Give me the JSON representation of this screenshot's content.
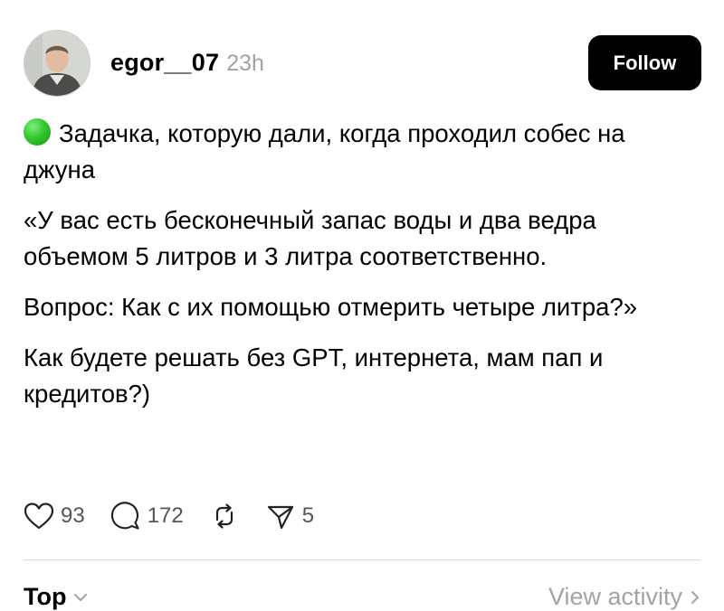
{
  "post": {
    "author": {
      "username": "egor__07",
      "time_ago": "23h"
    },
    "follow_label": "Follow",
    "status_dot_color": "#2fbf2b",
    "paragraphs": [
      "Задачка, которую дали, когда проходил собес на джуна",
      "«У вас есть бесконечный запас воды и два ведра объемом 5 литров и 3 литра соответственно.",
      "Вопрос: Как с их помощью отмерить четыре литра?»",
      "Как будете решать без GPT, интернета, мам пап и кредитов?)"
    ]
  },
  "actions": {
    "likes": "93",
    "comments": "172",
    "shares": "5",
    "icons": [
      "heart-icon",
      "comment-icon",
      "repost-icon",
      "share-icon"
    ]
  },
  "footer": {
    "sort_label": "Top",
    "view_activity_label": "View activity"
  }
}
